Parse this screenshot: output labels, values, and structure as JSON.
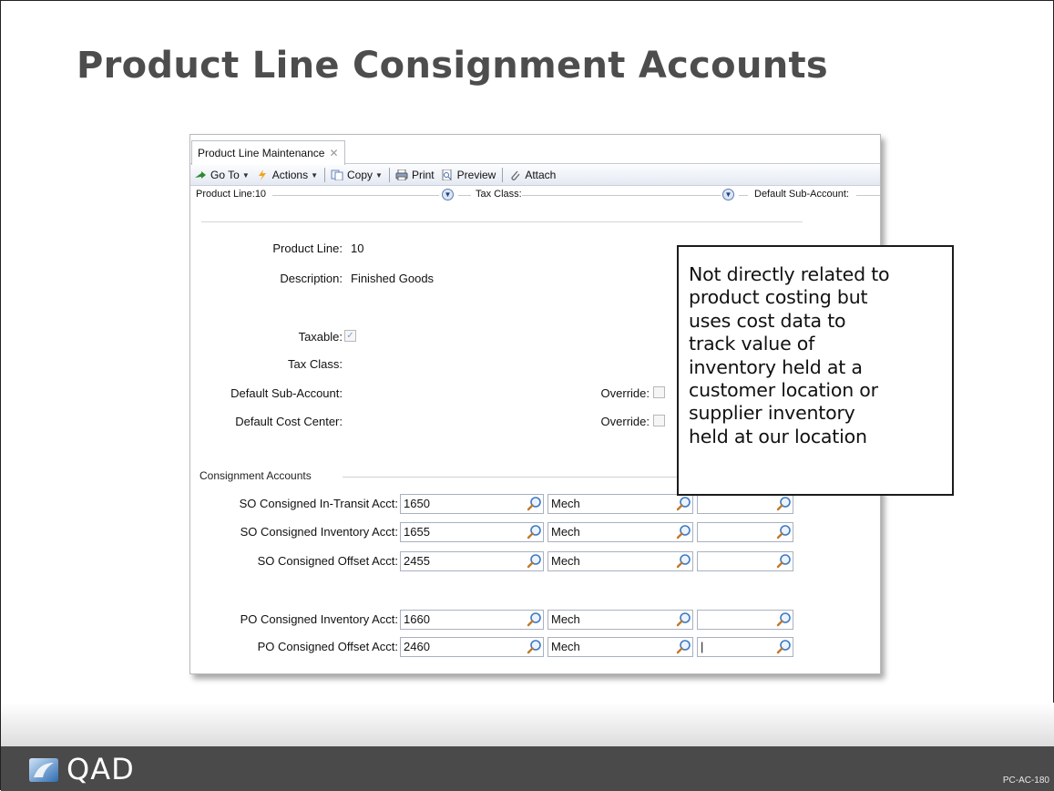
{
  "slide": {
    "title": "Product Line Consignment Accounts",
    "logo_text": "QAD",
    "code": "PC-AC-180"
  },
  "window": {
    "tab_label": "Product Line Maintenance",
    "tab_close": "✕",
    "toolbar": {
      "goto": "Go To",
      "actions": "Actions",
      "copy": "Copy",
      "print": "Print",
      "preview": "Preview",
      "attach": "Attach"
    },
    "collapse": {
      "product_line": "Product Line:10",
      "tax_class": "Tax Class:",
      "default_sub_account": "Default Sub-Account:"
    },
    "form": {
      "product_line_label": "Product Line:",
      "product_line_value": "10",
      "description_label": "Description:",
      "description_value": "Finished Goods",
      "taxable_label": "Taxable:",
      "taxable_checked": true,
      "tax_class_label": "Tax Class:",
      "default_sub_account_label": "Default Sub-Account:",
      "default_cost_center_label": "Default Cost Center:",
      "override_label": "Override:"
    },
    "consignment": {
      "group_title": "Consignment Accounts",
      "rows": [
        {
          "label": "SO Consigned In-Transit Acct:",
          "account": "1650",
          "sub": "Mech",
          "cc": ""
        },
        {
          "label": "SO Consigned Inventory Acct:",
          "account": "1655",
          "sub": "Mech",
          "cc": ""
        },
        {
          "label": "SO Consigned Offset Acct:",
          "account": "2455",
          "sub": "Mech",
          "cc": ""
        },
        {
          "label": "PO Consigned Inventory Acct:",
          "account": "1660",
          "sub": "Mech",
          "cc": ""
        },
        {
          "label": "PO Consigned Offset Acct:",
          "account": "2460",
          "sub": "Mech",
          "cc": "|"
        }
      ]
    }
  },
  "callout": {
    "lines": [
      "Not directly related to",
      "product costing but",
      "uses cost data to",
      "track value of",
      "inventory held at a",
      "customer location or",
      "supplier inventory",
      "held at our location"
    ]
  },
  "colors": {
    "title": "#4d4d4d",
    "footer": "#4a4a4a",
    "toolbar_accent": "#5c7bb0"
  }
}
